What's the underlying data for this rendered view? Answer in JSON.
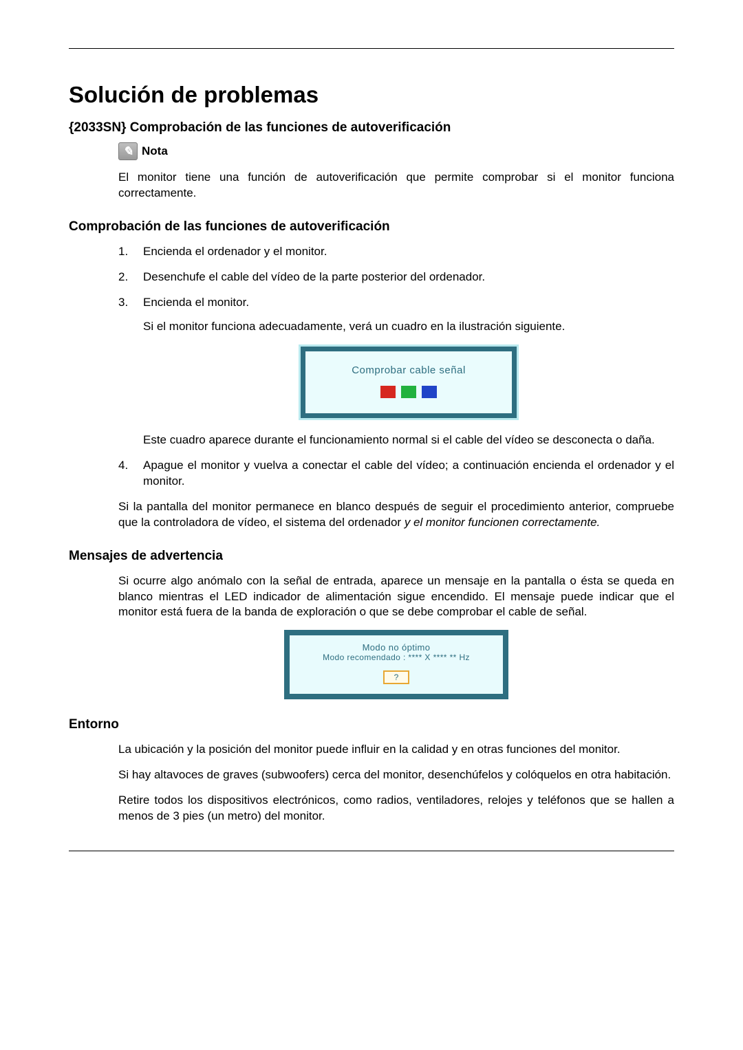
{
  "title": "Solución de problemas",
  "section1": {
    "heading": "{2033SN} Comprobación de las funciones de autoverificación",
    "nota_label": "Nota",
    "nota_text": "El monitor tiene una función de autoverificación que permite comprobar si el monitor funciona correctamente."
  },
  "section2": {
    "heading": "Comprobación de las funciones de autoverificación",
    "steps": {
      "s1": "Encienda el ordenador y el monitor.",
      "s2": "Desenchufe el cable del vídeo de la parte posterior del ordenador.",
      "s3": "Encienda el monitor.",
      "s3_sub": "Si el monitor funciona adecuadamente, verá un cuadro en la ilustración siguiente.",
      "s3_after": "Este cuadro aparece durante el funcionamiento normal si el cable del vídeo se desconecta o daña.",
      "s4": "Apague el monitor y vuelva a conectar el cable del vídeo; a continuación encienda el ordenador y el monitor."
    },
    "tail_plain": "Si la pantalla del monitor permanece en blanco después de seguir el procedimiento anterior, compruebe que la controladora de vídeo, el sistema del ordenador ",
    "tail_italic": "y el monitor funcionen correctamente."
  },
  "osd1": {
    "text": "Comprobar cable señal"
  },
  "section3": {
    "heading": "Mensajes de advertencia",
    "text": "Si ocurre algo anómalo con la señal de entrada, aparece un mensaje en la pantalla o ésta se queda en blanco mientras el LED indicador de alimentación sigue encendido. El mensaje puede indicar que el monitor está fuera de la banda de exploración o que se debe comprobar el cable de señal."
  },
  "osd2": {
    "line1": "Modo no óptimo",
    "line2": "Modo recomendado : **** X **** ** Hz",
    "button": "?"
  },
  "section4": {
    "heading": "Entorno",
    "p1": "La ubicación y la posición del monitor puede influir en la calidad y en otras funciones del monitor.",
    "p2": "Si hay altavoces de graves (subwoofers) cerca del monitor, desenchúfelos y colóquelos en otra habitación.",
    "p3": "Retire todos los dispositivos electrónicos, como radios, ventiladores, relojes y teléfonos que se hallen a menos de 3 pies (un metro) del monitor."
  }
}
